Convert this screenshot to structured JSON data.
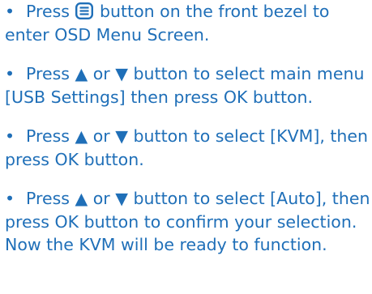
{
  "colors": {
    "text": "#1f6fb8"
  },
  "bullet": "•",
  "steps": [
    {
      "before_icon": "Press",
      "icon": "menu-icon",
      "after_icon": "button on the front bezel to enter OSD Menu Screen."
    },
    {
      "text": "Press ▲ or ▼ button to select main menu [USB Settings] then press OK button."
    },
    {
      "text": "Press ▲ or ▼ button to select [KVM], then press OK button."
    },
    {
      "text": "Press ▲ or ▼ button to select [Auto], then press OK button to confirm your selection. Now the KVM will be ready to function."
    }
  ]
}
